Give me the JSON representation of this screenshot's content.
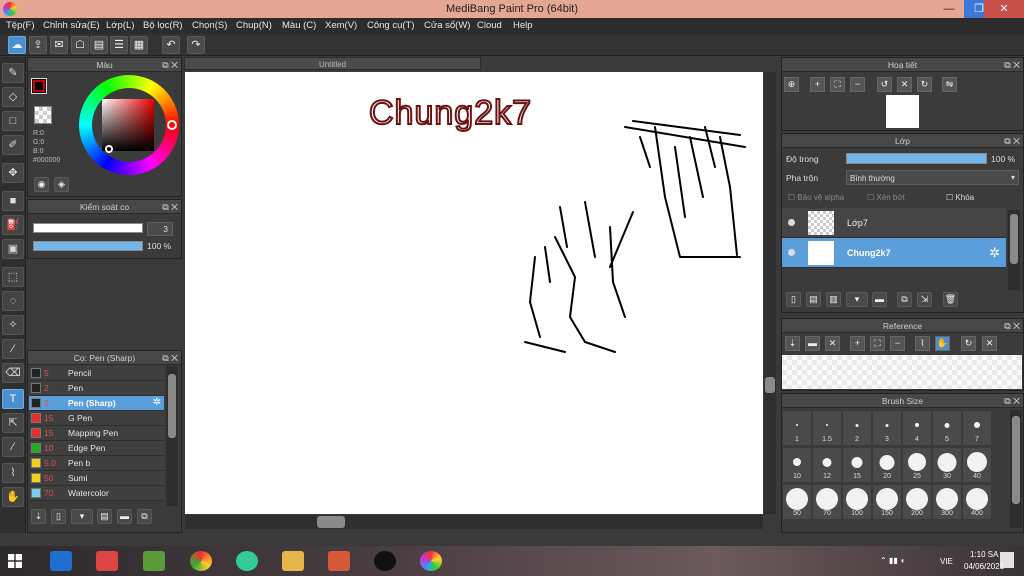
{
  "window": {
    "title": "MediBang Paint Pro (64bit)",
    "minimize": "—",
    "restore": "❐",
    "close": "✕"
  },
  "menu": [
    "Tệp(F)",
    "Chỉnh sửa(E)",
    "Lớp(L)",
    "Bộ lọc(R)",
    "Chọn(S)",
    "Chup(N)",
    "Màu (C)",
    "Xem(V)",
    "Công cụ(T)",
    "Cửa sổ(W)",
    "Cloud",
    "Help"
  ],
  "toolbar_icons": [
    "cloud-icon",
    "export-icon",
    "comment-icon",
    "chat-icon",
    "page-icon",
    "page-list-icon",
    "grid-icon",
    "undo-icon",
    "redo-icon"
  ],
  "color_panel": {
    "title": "Màu",
    "r": "R:0",
    "g": "G:0",
    "b": "B:0",
    "hex": "#000000",
    "foreground": "#000000"
  },
  "brush_control": {
    "title": "Kiểm soát co",
    "size": "3",
    "opacity": "100 %"
  },
  "brush_list": {
    "title": "Cọ: Pen (Sharp)",
    "items": [
      {
        "num": "5",
        "name": "Pencil",
        "color": "#222222"
      },
      {
        "num": "2",
        "name": "Pen",
        "color": "#222222"
      },
      {
        "num": "3",
        "name": "Pen (Sharp)",
        "color": "#222222"
      },
      {
        "num": "15",
        "name": "G Pen",
        "color": "#e03030"
      },
      {
        "num": "15",
        "name": "Mapping Pen",
        "color": "#e03030"
      },
      {
        "num": "10",
        "name": "Edge Pen",
        "color": "#22aa22"
      },
      {
        "num": "5.0",
        "name": "Pen b",
        "color": "#f0d020"
      },
      {
        "num": "50",
        "name": "Sumi",
        "color": "#f0d020"
      },
      {
        "num": "70",
        "name": "Watercolor",
        "color": "#7ad0f0"
      }
    ]
  },
  "document": {
    "tab": "Untitled",
    "text": "Chung2k7"
  },
  "navigator": {
    "title": "Hoạ tiết"
  },
  "layer_panel": {
    "title": "Lớp",
    "opacity_label": "Độ trong",
    "opacity_value": "100 %",
    "blend_label": "Pha trộn",
    "blend_value": "Bình thường",
    "opt_alpha": "Bảo vệ alpha",
    "opt_clip": "Xén bớt",
    "opt_lock": "Khóa",
    "layers": [
      {
        "name": "Lớp7"
      },
      {
        "name": "Chung2k7"
      }
    ]
  },
  "reference": {
    "title": "Reference"
  },
  "brush_size": {
    "title": "Brush Size",
    "sizes": [
      "1",
      "1.5",
      "2",
      "3",
      "4",
      "5",
      "7",
      "10",
      "12",
      "15",
      "20",
      "25",
      "30",
      "40",
      "50",
      "70",
      "100",
      "150",
      "200",
      "300",
      "400"
    ]
  },
  "taskbar": {
    "time": "1:10 SA",
    "date": "04/06/2021",
    "lang": "VIE"
  }
}
